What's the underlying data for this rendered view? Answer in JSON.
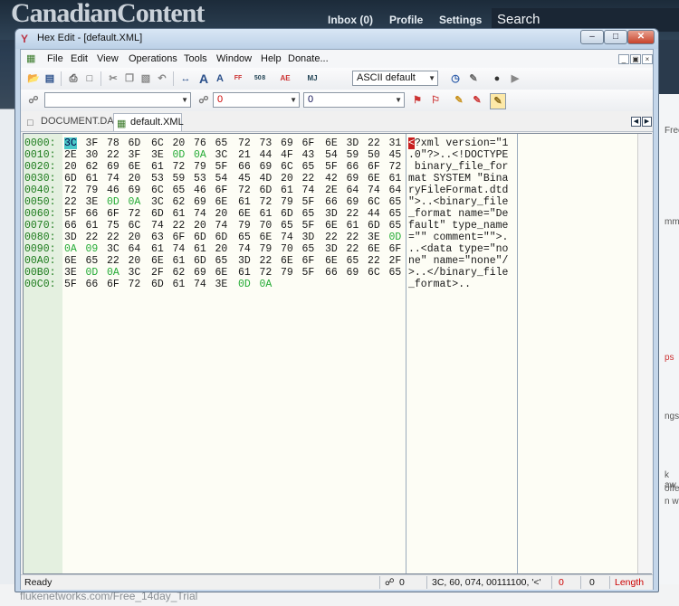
{
  "background": {
    "logo": "CanadianContent",
    "nav": [
      "Inbox (0)",
      "Profile",
      "Settings"
    ],
    "search_label": "Search",
    "footer_text": "flukenetworks.com/Free_14day_Trial",
    "side_fragments": [
      "Free",
      "mm",
      "ps",
      "ngs.",
      "k aw",
      "offe",
      "n w"
    ]
  },
  "window": {
    "title": "Hex Edit - [default.XML]",
    "controls": [
      "minimize",
      "maximize",
      "close"
    ]
  },
  "menu": [
    "File",
    "Edit",
    "View",
    "Operations",
    "Tools",
    "Window",
    "Help",
    "Donate..."
  ],
  "toolbar": {
    "char_set": "ASCII default",
    "icons1": [
      "open-icon",
      "save-icon",
      "print-icon",
      "print-preview-icon",
      "cut-icon",
      "copy-icon",
      "paste-icon",
      "undo-icon",
      "autofit-icon",
      "font-larger-icon",
      "font-smaller-icon",
      "char-set-icon",
      "decimal-icon",
      "case-icon",
      "mark-icon",
      "clock-icon",
      "pen-icon",
      "record-icon",
      "play-icon"
    ],
    "search_value": "",
    "address_value": "0",
    "address2_value": "0"
  },
  "tabs": [
    {
      "label": "DOCUMENT.DAT",
      "active": false
    },
    {
      "label": "default.XML",
      "active": true
    }
  ],
  "hex_rows": [
    {
      "addr": "0000:",
      "bytes": [
        "3C",
        "3F",
        "78",
        "6D",
        "6C",
        "20",
        "76",
        "65",
        "72",
        "73",
        "69",
        "6F",
        "6E",
        "3D",
        "22",
        "31"
      ],
      "ascii": "<?xml version=\"1"
    },
    {
      "addr": "0010:",
      "bytes": [
        "2E",
        "30",
        "22",
        "3F",
        "3E",
        "0D",
        "0A",
        "3C",
        "21",
        "44",
        "4F",
        "43",
        "54",
        "59",
        "50",
        "45"
      ],
      "ascii": ".0\"?>..<!DOCTYPE"
    },
    {
      "addr": "0020:",
      "bytes": [
        "20",
        "62",
        "69",
        "6E",
        "61",
        "72",
        "79",
        "5F",
        "66",
        "69",
        "6C",
        "65",
        "5F",
        "66",
        "6F",
        "72"
      ],
      "ascii": " binary_file_for"
    },
    {
      "addr": "0030:",
      "bytes": [
        "6D",
        "61",
        "74",
        "20",
        "53",
        "59",
        "53",
        "54",
        "45",
        "4D",
        "20",
        "22",
        "42",
        "69",
        "6E",
        "61"
      ],
      "ascii": "mat SYSTEM \"Bina"
    },
    {
      "addr": "0040:",
      "bytes": [
        "72",
        "79",
        "46",
        "69",
        "6C",
        "65",
        "46",
        "6F",
        "72",
        "6D",
        "61",
        "74",
        "2E",
        "64",
        "74",
        "64"
      ],
      "ascii": "ryFileFormat.dtd"
    },
    {
      "addr": "0050:",
      "bytes": [
        "22",
        "3E",
        "0D",
        "0A",
        "3C",
        "62",
        "69",
        "6E",
        "61",
        "72",
        "79",
        "5F",
        "66",
        "69",
        "6C",
        "65"
      ],
      "ascii": "\">..<binary_file"
    },
    {
      "addr": "0060:",
      "bytes": [
        "5F",
        "66",
        "6F",
        "72",
        "6D",
        "61",
        "74",
        "20",
        "6E",
        "61",
        "6D",
        "65",
        "3D",
        "22",
        "44",
        "65"
      ],
      "ascii": "_format name=\"De"
    },
    {
      "addr": "0070:",
      "bytes": [
        "66",
        "61",
        "75",
        "6C",
        "74",
        "22",
        "20",
        "74",
        "79",
        "70",
        "65",
        "5F",
        "6E",
        "61",
        "6D",
        "65"
      ],
      "ascii": "fault\" type_name"
    },
    {
      "addr": "0080:",
      "bytes": [
        "3D",
        "22",
        "22",
        "20",
        "63",
        "6F",
        "6D",
        "6D",
        "65",
        "6E",
        "74",
        "3D",
        "22",
        "22",
        "3E",
        "0D"
      ],
      "ascii": "=\"\" comment=\"\">."
    },
    {
      "addr": "0090:",
      "bytes": [
        "0A",
        "09",
        "3C",
        "64",
        "61",
        "74",
        "61",
        "20",
        "74",
        "79",
        "70",
        "65",
        "3D",
        "22",
        "6E",
        "6F"
      ],
      "ascii": "..<data type=\"no"
    },
    {
      "addr": "00A0:",
      "bytes": [
        "6E",
        "65",
        "22",
        "20",
        "6E",
        "61",
        "6D",
        "65",
        "3D",
        "22",
        "6E",
        "6F",
        "6E",
        "65",
        "22",
        "2F"
      ],
      "ascii": "ne\" name=\"none\"/"
    },
    {
      "addr": "00B0:",
      "bytes": [
        "3E",
        "0D",
        "0A",
        "3C",
        "2F",
        "62",
        "69",
        "6E",
        "61",
        "72",
        "79",
        "5F",
        "66",
        "69",
        "6C",
        "65"
      ],
      "ascii": ">..</binary_file"
    },
    {
      "addr": "00C0:",
      "bytes": [
        "5F",
        "66",
        "6F",
        "72",
        "6D",
        "61",
        "74",
        "3E",
        "0D",
        "0A"
      ],
      "ascii": "_format>.."
    }
  ],
  "status": {
    "ready": "Ready",
    "find_count": "0",
    "char_info": "3C, 60, 074, 00111100, '<'",
    "sel_start": "0",
    "sel_len": "0",
    "length_label": "Length"
  },
  "colors": {
    "selected_byte": "#49c8c8",
    "control_byte": "#22aa33",
    "address": "#1a7a1a",
    "cursor": "#c81e1e"
  }
}
